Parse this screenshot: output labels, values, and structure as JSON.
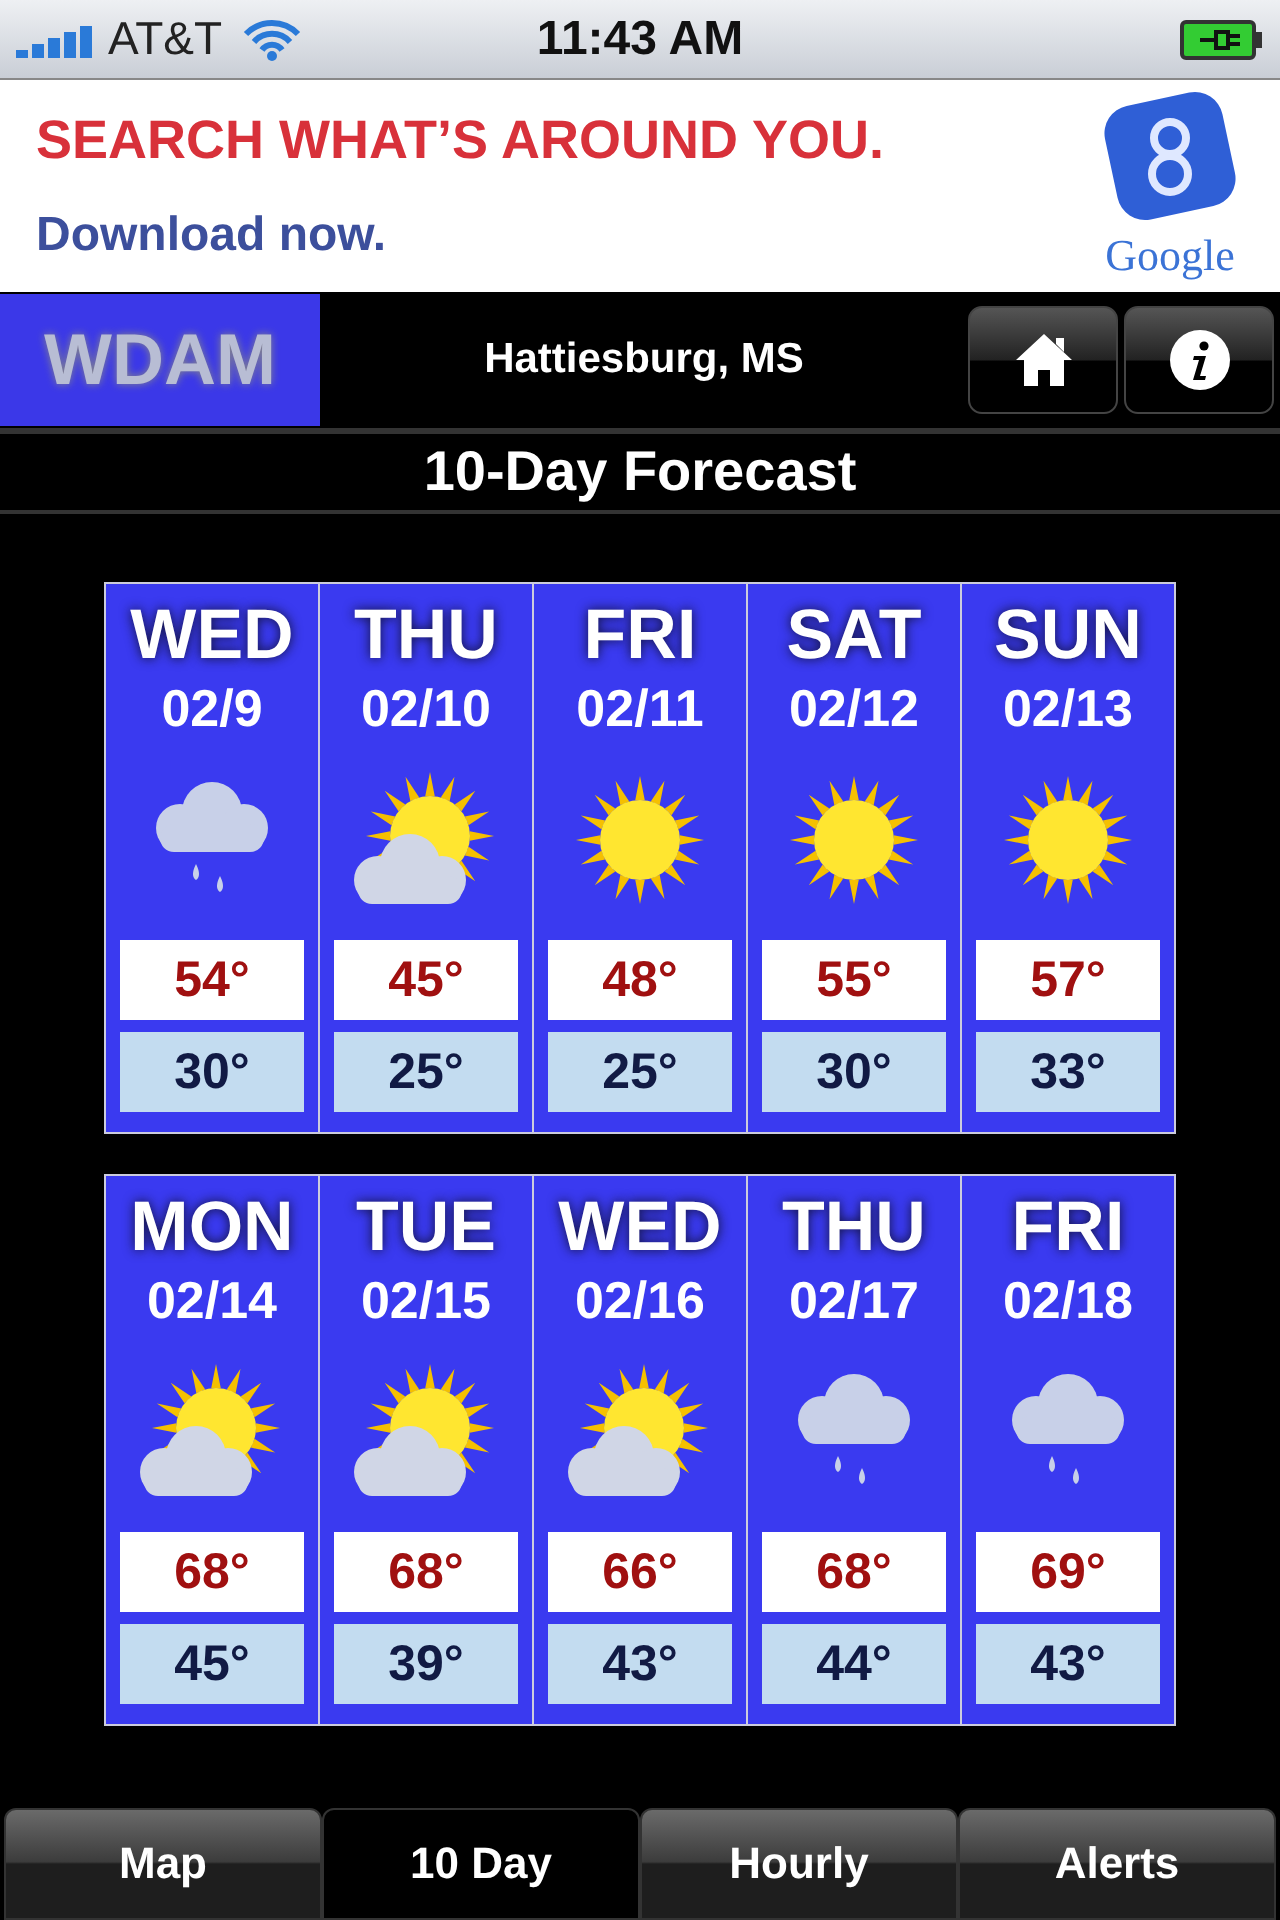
{
  "status_bar": {
    "carrier": "AT&T",
    "time": "11:43 AM"
  },
  "ad": {
    "headline": "SEARCH WHAT’S AROUND YOU.",
    "subline": "Download now.",
    "brand": "Google"
  },
  "header": {
    "logo": "WDAM",
    "location": "Hattiesburg, MS"
  },
  "title": "10-Day Forecast",
  "weeks": [
    [
      {
        "day": "WED",
        "date": "02/9",
        "kind": "rain",
        "high": "54°",
        "low": "30°"
      },
      {
        "day": "THU",
        "date": "02/10",
        "kind": "partly",
        "high": "45°",
        "low": "25°"
      },
      {
        "day": "FRI",
        "date": "02/11",
        "kind": "sun",
        "high": "48°",
        "low": "25°"
      },
      {
        "day": "SAT",
        "date": "02/12",
        "kind": "sun",
        "high": "55°",
        "low": "30°"
      },
      {
        "day": "SUN",
        "date": "02/13",
        "kind": "sun",
        "high": "57°",
        "low": "33°"
      }
    ],
    [
      {
        "day": "MON",
        "date": "02/14",
        "kind": "partly",
        "high": "68°",
        "low": "45°"
      },
      {
        "day": "TUE",
        "date": "02/15",
        "kind": "partly",
        "high": "68°",
        "low": "39°"
      },
      {
        "day": "WED",
        "date": "02/16",
        "kind": "partly",
        "high": "66°",
        "low": "43°"
      },
      {
        "day": "THU",
        "date": "02/17",
        "kind": "rain",
        "high": "68°",
        "low": "44°"
      },
      {
        "day": "FRI",
        "date": "02/18",
        "kind": "rain",
        "high": "69°",
        "low": "43°"
      }
    ]
  ],
  "tabs": [
    {
      "label": "Map",
      "selected": false
    },
    {
      "label": "10 Day",
      "selected": true
    },
    {
      "label": "Hourly",
      "selected": false
    },
    {
      "label": "Alerts",
      "selected": false
    }
  ]
}
